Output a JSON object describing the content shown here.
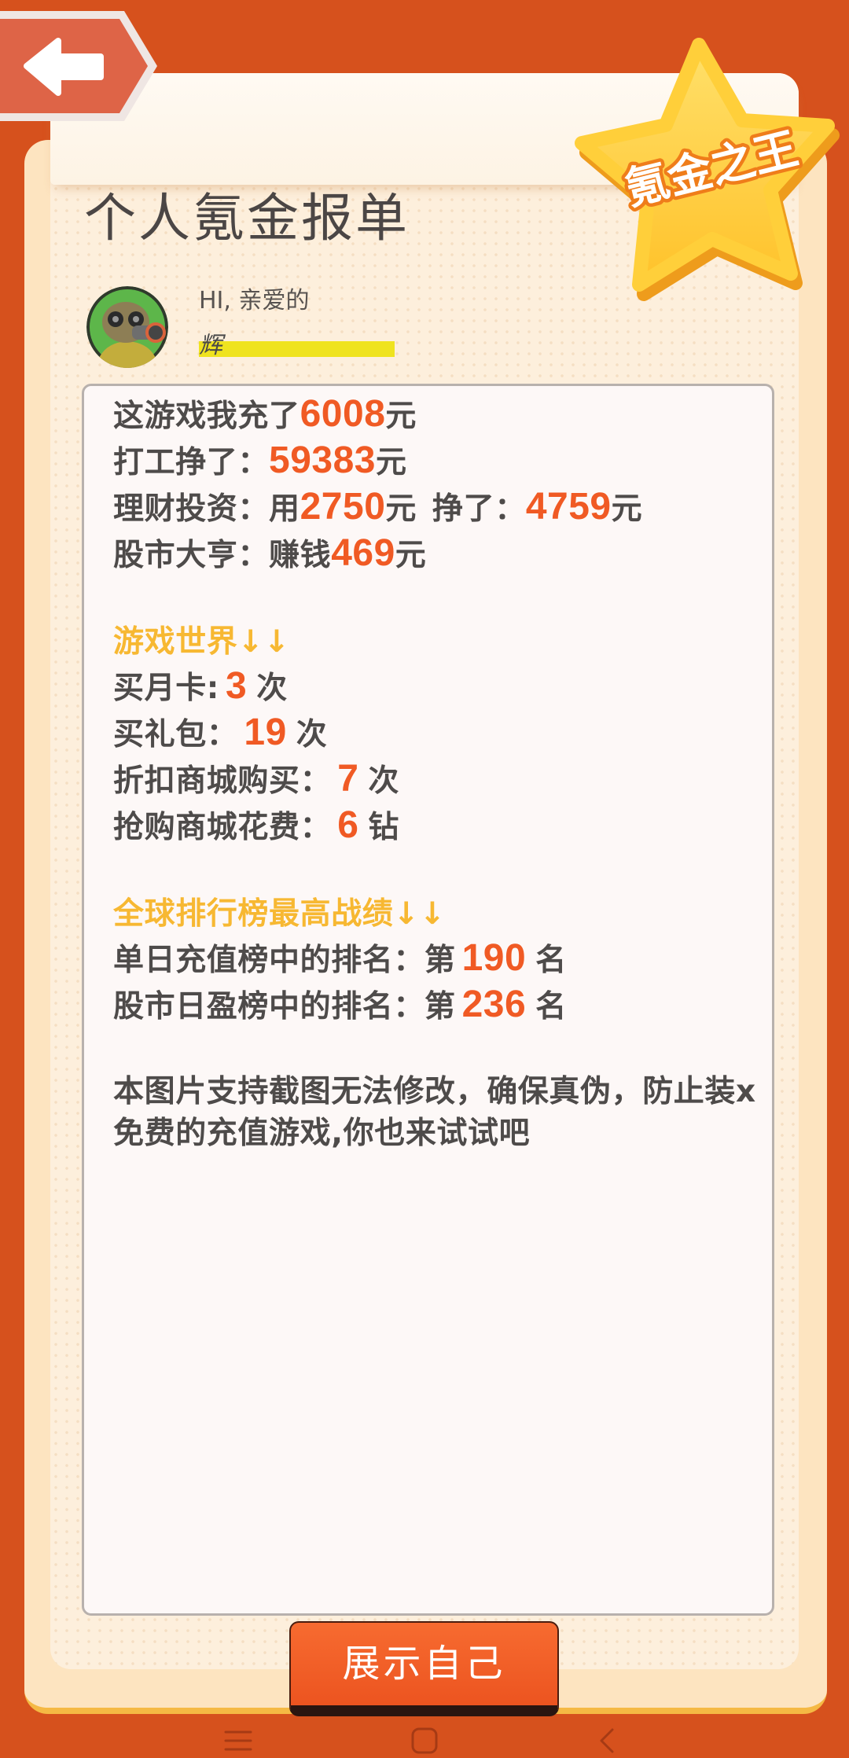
{
  "colors": {
    "background": "#d6511d",
    "paper": "#fdefdc",
    "text": "#4e4b4a",
    "number": "#f05a24",
    "heading": "#f7b832",
    "badge": "#ffc933",
    "button": "#f05d26",
    "name_highlight": "#efe31f"
  },
  "header": {
    "back_icon": "back-arrow-icon",
    "badge_icon": "star-badge-icon",
    "badge_text": "氪金之王"
  },
  "report": {
    "title": "个人氪金报单",
    "avatar_icon": "gas-mask-avatar-icon",
    "greeting": "HI, 亲爱的",
    "username": "辉"
  },
  "summary": {
    "recharge": {
      "label": "这游戏我充了",
      "value": 6008,
      "unit": "元"
    },
    "work": {
      "label": "打工挣了：",
      "value": 59383,
      "unit": "元"
    },
    "invest": {
      "label": "理财投资：用",
      "spent": 2750,
      "spent_unit": "元",
      "earned_label": "挣了：",
      "earned": 4759,
      "earned_unit": "元"
    },
    "stock": {
      "label": "股市大亨：赚钱",
      "value": 469,
      "unit": "元"
    }
  },
  "game_world": {
    "heading": "游戏世界↓↓",
    "items": [
      {
        "label": "买月卡:",
        "value": 3,
        "unit": "次"
      },
      {
        "label": "买礼包：",
        "value": 19,
        "unit": "次"
      },
      {
        "label": "折扣商城购买：",
        "value": 7,
        "unit": "次"
      },
      {
        "label": "抢购商城花费：",
        "value": 6,
        "unit": "钻"
      }
    ]
  },
  "ranking": {
    "heading": "全球排行榜最高战绩↓↓",
    "items": [
      {
        "label": "单日充值榜中的排名：第",
        "value": 190,
        "unit": "名"
      },
      {
        "label": "股市日盈榜中的排名：第",
        "value": 236,
        "unit": "名"
      }
    ]
  },
  "notes": [
    "本图片支持截图无法修改，确保真伪，防止装x",
    "免费的充值游戏,你也来试试吧"
  ],
  "share_button": {
    "label": "展示自己"
  },
  "system_nav": {
    "menu_icon": "menu-icon",
    "home_icon": "home-icon",
    "back_icon": "back-icon"
  }
}
